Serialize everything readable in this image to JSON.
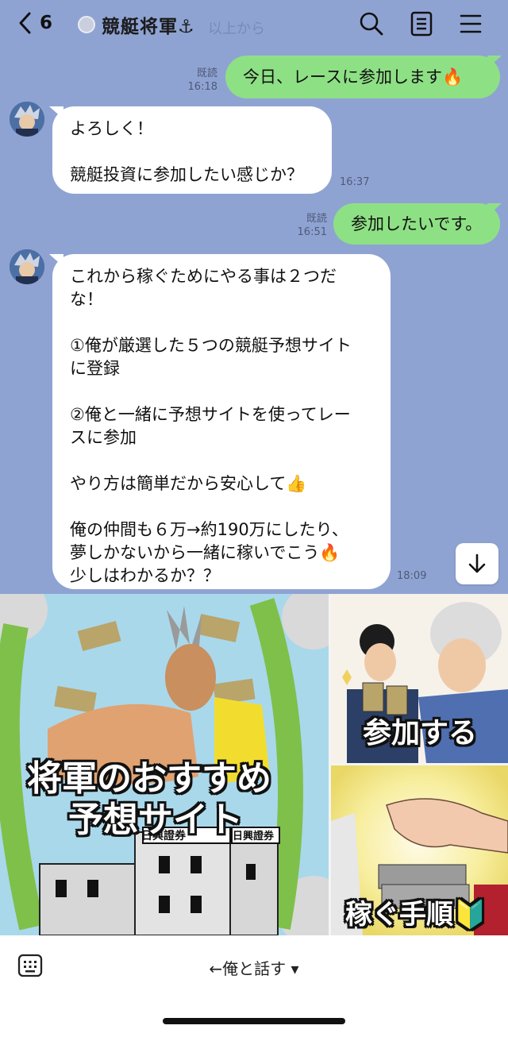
{
  "header": {
    "back_count": "6",
    "title": "競艇将軍⚓",
    "ghost_text": "以上から"
  },
  "messages": [
    {
      "from": "me",
      "text": "今日、レースに参加します🔥",
      "read": "既読",
      "time": "16:18"
    },
    {
      "from": "them",
      "lines": [
        "よろしく！",
        "",
        "競艇投資に参加したい感じか？"
      ],
      "time": "16:37"
    },
    {
      "from": "me",
      "text": "参加したいです。",
      "read": "既読",
      "time": "16:51"
    },
    {
      "from": "them",
      "lines": [
        "これから稼ぐためにやる事は２つだ",
        "な！",
        "",
        "①俺が厳選した５つの競艇予想サイト",
        "に登録",
        "",
        "②俺と一緒に予想サイトを使ってレー",
        "スに参加",
        "",
        "やり方は簡単だから安心して👍",
        "",
        "俺の仲間も６万→約190万にしたり、",
        "夢しかないから一緒に稼いでこう🔥",
        "少しはわかるか？？"
      ],
      "time": "18:09"
    }
  ],
  "rich_menu": {
    "main": {
      "line1": "将軍のおすすめ",
      "line2": "予想サイト",
      "sign": "日興證券",
      "sign2": "日興證券"
    },
    "join": "参加する",
    "steps": "稼ぐ手順🔰"
  },
  "bottom": {
    "talk_label": "←俺と話す ▾"
  },
  "colors": {
    "background": "#8fa3d3",
    "my_bubble": "#8ee085",
    "their_bubble": "#ffffff"
  },
  "icons": [
    "back-chevron-icon",
    "search-icon",
    "notes-icon",
    "menu-icon",
    "arrow-down-icon",
    "keyboard-icon"
  ]
}
